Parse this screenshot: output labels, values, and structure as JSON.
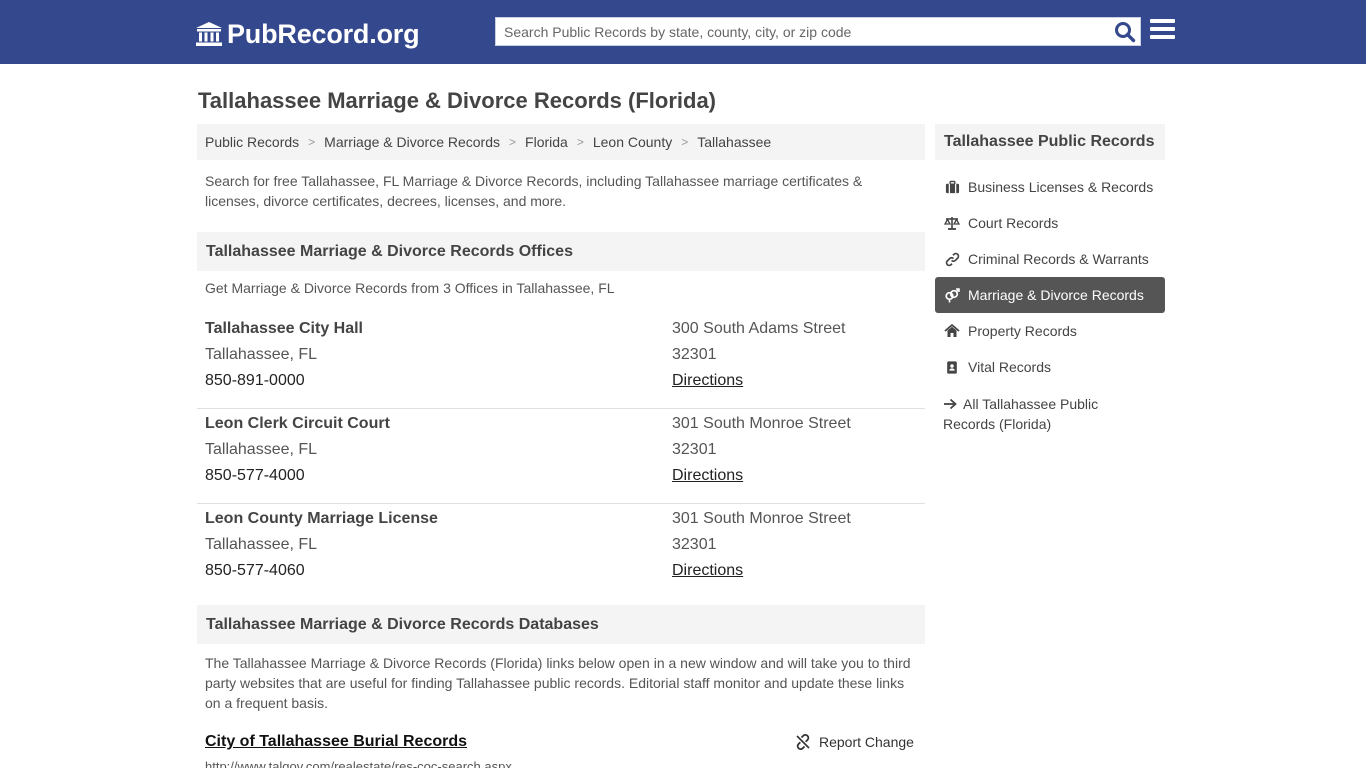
{
  "header": {
    "logo_text": "PubRecord.org",
    "search_placeholder": "Search Public Records by state, county, city, or zip code"
  },
  "page_title": "Tallahassee Marriage & Divorce Records (Florida)",
  "breadcrumb": [
    "Public Records",
    "Marriage & Divorce Records",
    "Florida",
    "Leon County",
    "Tallahassee"
  ],
  "intro": "Search for free Tallahassee, FL Marriage & Divorce Records, including Tallahassee marriage certificates & licenses, divorce certificates, decrees, licenses, and more.",
  "offices_section": {
    "title": "Tallahassee Marriage & Divorce Records Offices",
    "intro": "Get Marriage & Divorce Records from 3 Offices in Tallahassee, FL",
    "offices": [
      {
        "name": "Tallahassee City Hall",
        "city": "Tallahassee, FL",
        "phone": "850-891-0000",
        "street": "300 South Adams Street",
        "zip": "32301",
        "directions": "Directions"
      },
      {
        "name": "Leon Clerk Circuit Court",
        "city": "Tallahassee, FL",
        "phone": "850-577-4000",
        "street": "301 South Monroe Street",
        "zip": "32301",
        "directions": "Directions"
      },
      {
        "name": "Leon County Marriage License",
        "city": "Tallahassee, FL",
        "phone": "850-577-4060",
        "street": "301 South Monroe Street",
        "zip": "32301",
        "directions": "Directions"
      }
    ]
  },
  "databases_section": {
    "title": "Tallahassee Marriage & Divorce Records Databases",
    "intro": "The Tallahassee Marriage & Divorce Records (Florida) links below open in a new window and will take you to third party websites that are useful for finding Tallahassee public records. Editorial staff monitor and update these links on a frequent basis.",
    "first_link": "City of Tallahassee Burial Records",
    "first_url": "http://www.talgov.com/realestate/res-coc-search.aspx",
    "report_label": "Report Change"
  },
  "sidebar": {
    "title": "Tallahassee Public Records",
    "items": [
      {
        "label": "Business Licenses & Records",
        "icon": "briefcase-icon"
      },
      {
        "label": "Court Records",
        "icon": "scales-icon"
      },
      {
        "label": "Criminal Records & Warrants",
        "icon": "link-icon"
      },
      {
        "label": "Marriage & Divorce Records",
        "icon": "gender-icon",
        "active": true
      },
      {
        "label": "Property Records",
        "icon": "home-icon"
      },
      {
        "label": "Vital Records",
        "icon": "address-book-icon"
      }
    ],
    "all_link": "All Tallahassee Public Records (Florida)"
  },
  "colors": {
    "header_bg": "#34488e",
    "active_item_bg": "#555555",
    "section_bg": "#f4f4f4"
  }
}
